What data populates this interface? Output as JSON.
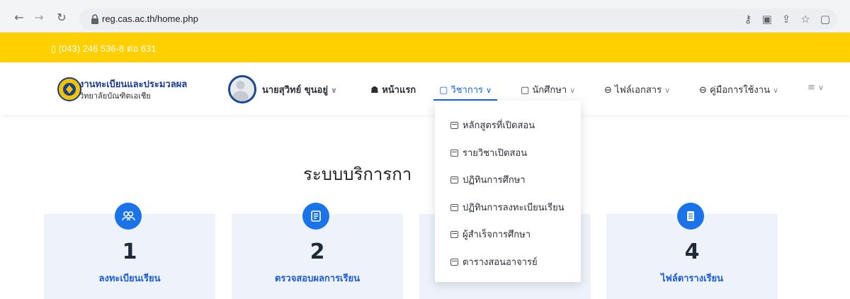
{
  "browser": {
    "url": "reg.cas.ac.th/home.php"
  },
  "topbar": {
    "phone": "(043) 246 536-8 ต่อ 631"
  },
  "header": {
    "site_title": "งานทะเบียนและประมวลผล",
    "site_subtitle": "วิทยาลัยบัณฑิตเอเชีย",
    "user_name": "นายสุวิทย์ ขุนอยู่",
    "menu": {
      "home": "หน้าแรก",
      "courses": "วิชาการ",
      "student": "นักศึกษา",
      "files": "ไฟล์เอกสาร",
      "manual": "คู่มือการใช้งาน"
    }
  },
  "dropdown": {
    "items": [
      "หลักสูตรที่เปิดสอน",
      "รายวิชาเปิดสอน",
      "ปฏิทินการศึกษา",
      "ปฏิทินการลงทะเบียนเรียน",
      "ผู้สำเร็จการศึกษา",
      "ตารางสอนอาจารย์"
    ]
  },
  "main": {
    "title": "ระบบบริการกา"
  },
  "cards": [
    {
      "number": "1",
      "label": "ลงทะเบียนเรียน",
      "icon": "users-icon"
    },
    {
      "number": "2",
      "label": "ตรวจสอบผลการเรียน",
      "icon": "notebook-icon"
    },
    {
      "number": "4",
      "label": "ไฟล์ตารางเรียน",
      "icon": "document-icon"
    }
  ],
  "colors": {
    "accent": "#1563e6",
    "yellow": "#ffd000",
    "brand_blue": "#1a3d8f"
  }
}
